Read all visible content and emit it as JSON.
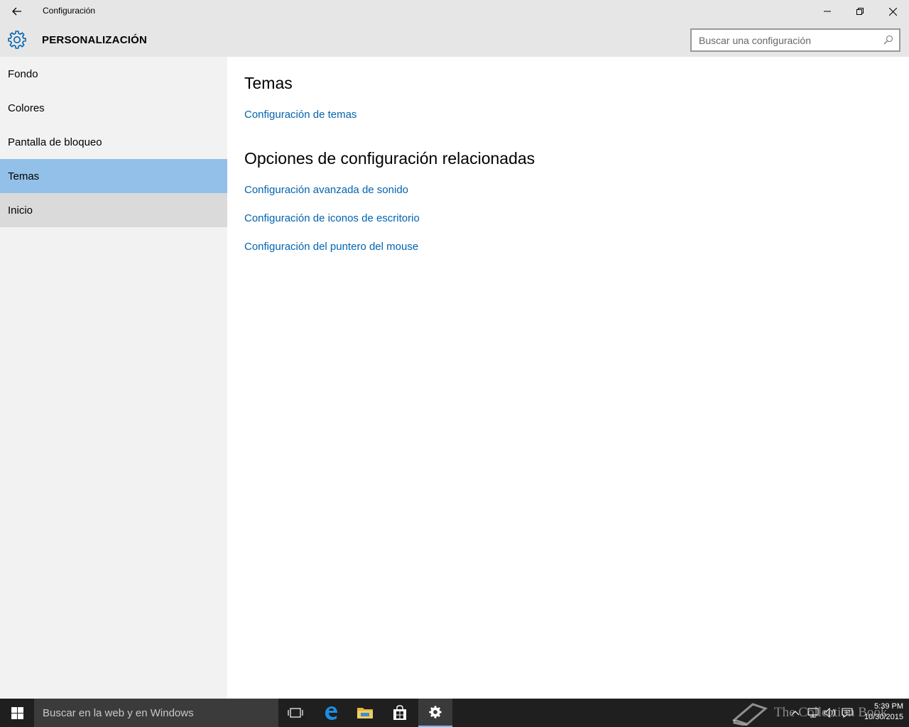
{
  "window": {
    "title": "Configuración",
    "back_icon": "arrow-left-icon"
  },
  "header": {
    "section_title": "PERSONALIZACIÓN",
    "search_placeholder": "Buscar una configuración"
  },
  "sidebar": {
    "items": [
      {
        "label": "Fondo"
      },
      {
        "label": "Colores"
      },
      {
        "label": "Pantalla de bloqueo"
      },
      {
        "label": "Temas"
      },
      {
        "label": "Inicio"
      }
    ],
    "selected": "Temas"
  },
  "main": {
    "section1_heading": "Temas",
    "section1_link": "Configuración de temas",
    "section2_heading": "Opciones de configuración relacionadas",
    "related_links": [
      "Configuración avanzada de sonido",
      "Configuración de iconos de escritorio",
      "Configuración del puntero del mouse"
    ]
  },
  "taskbar": {
    "search_text": "Buscar en la web y en Windows",
    "time": "5:39 PM",
    "date": "10/30/2015"
  },
  "watermark": {
    "text": "The Collection Book"
  },
  "colors": {
    "accent": "#0063b1",
    "selection": "#92c0e8",
    "sidebar_bg": "#f2f2f2",
    "titlebar_bg": "#e6e6e6",
    "taskbar_bg": "#1f1f1f"
  }
}
